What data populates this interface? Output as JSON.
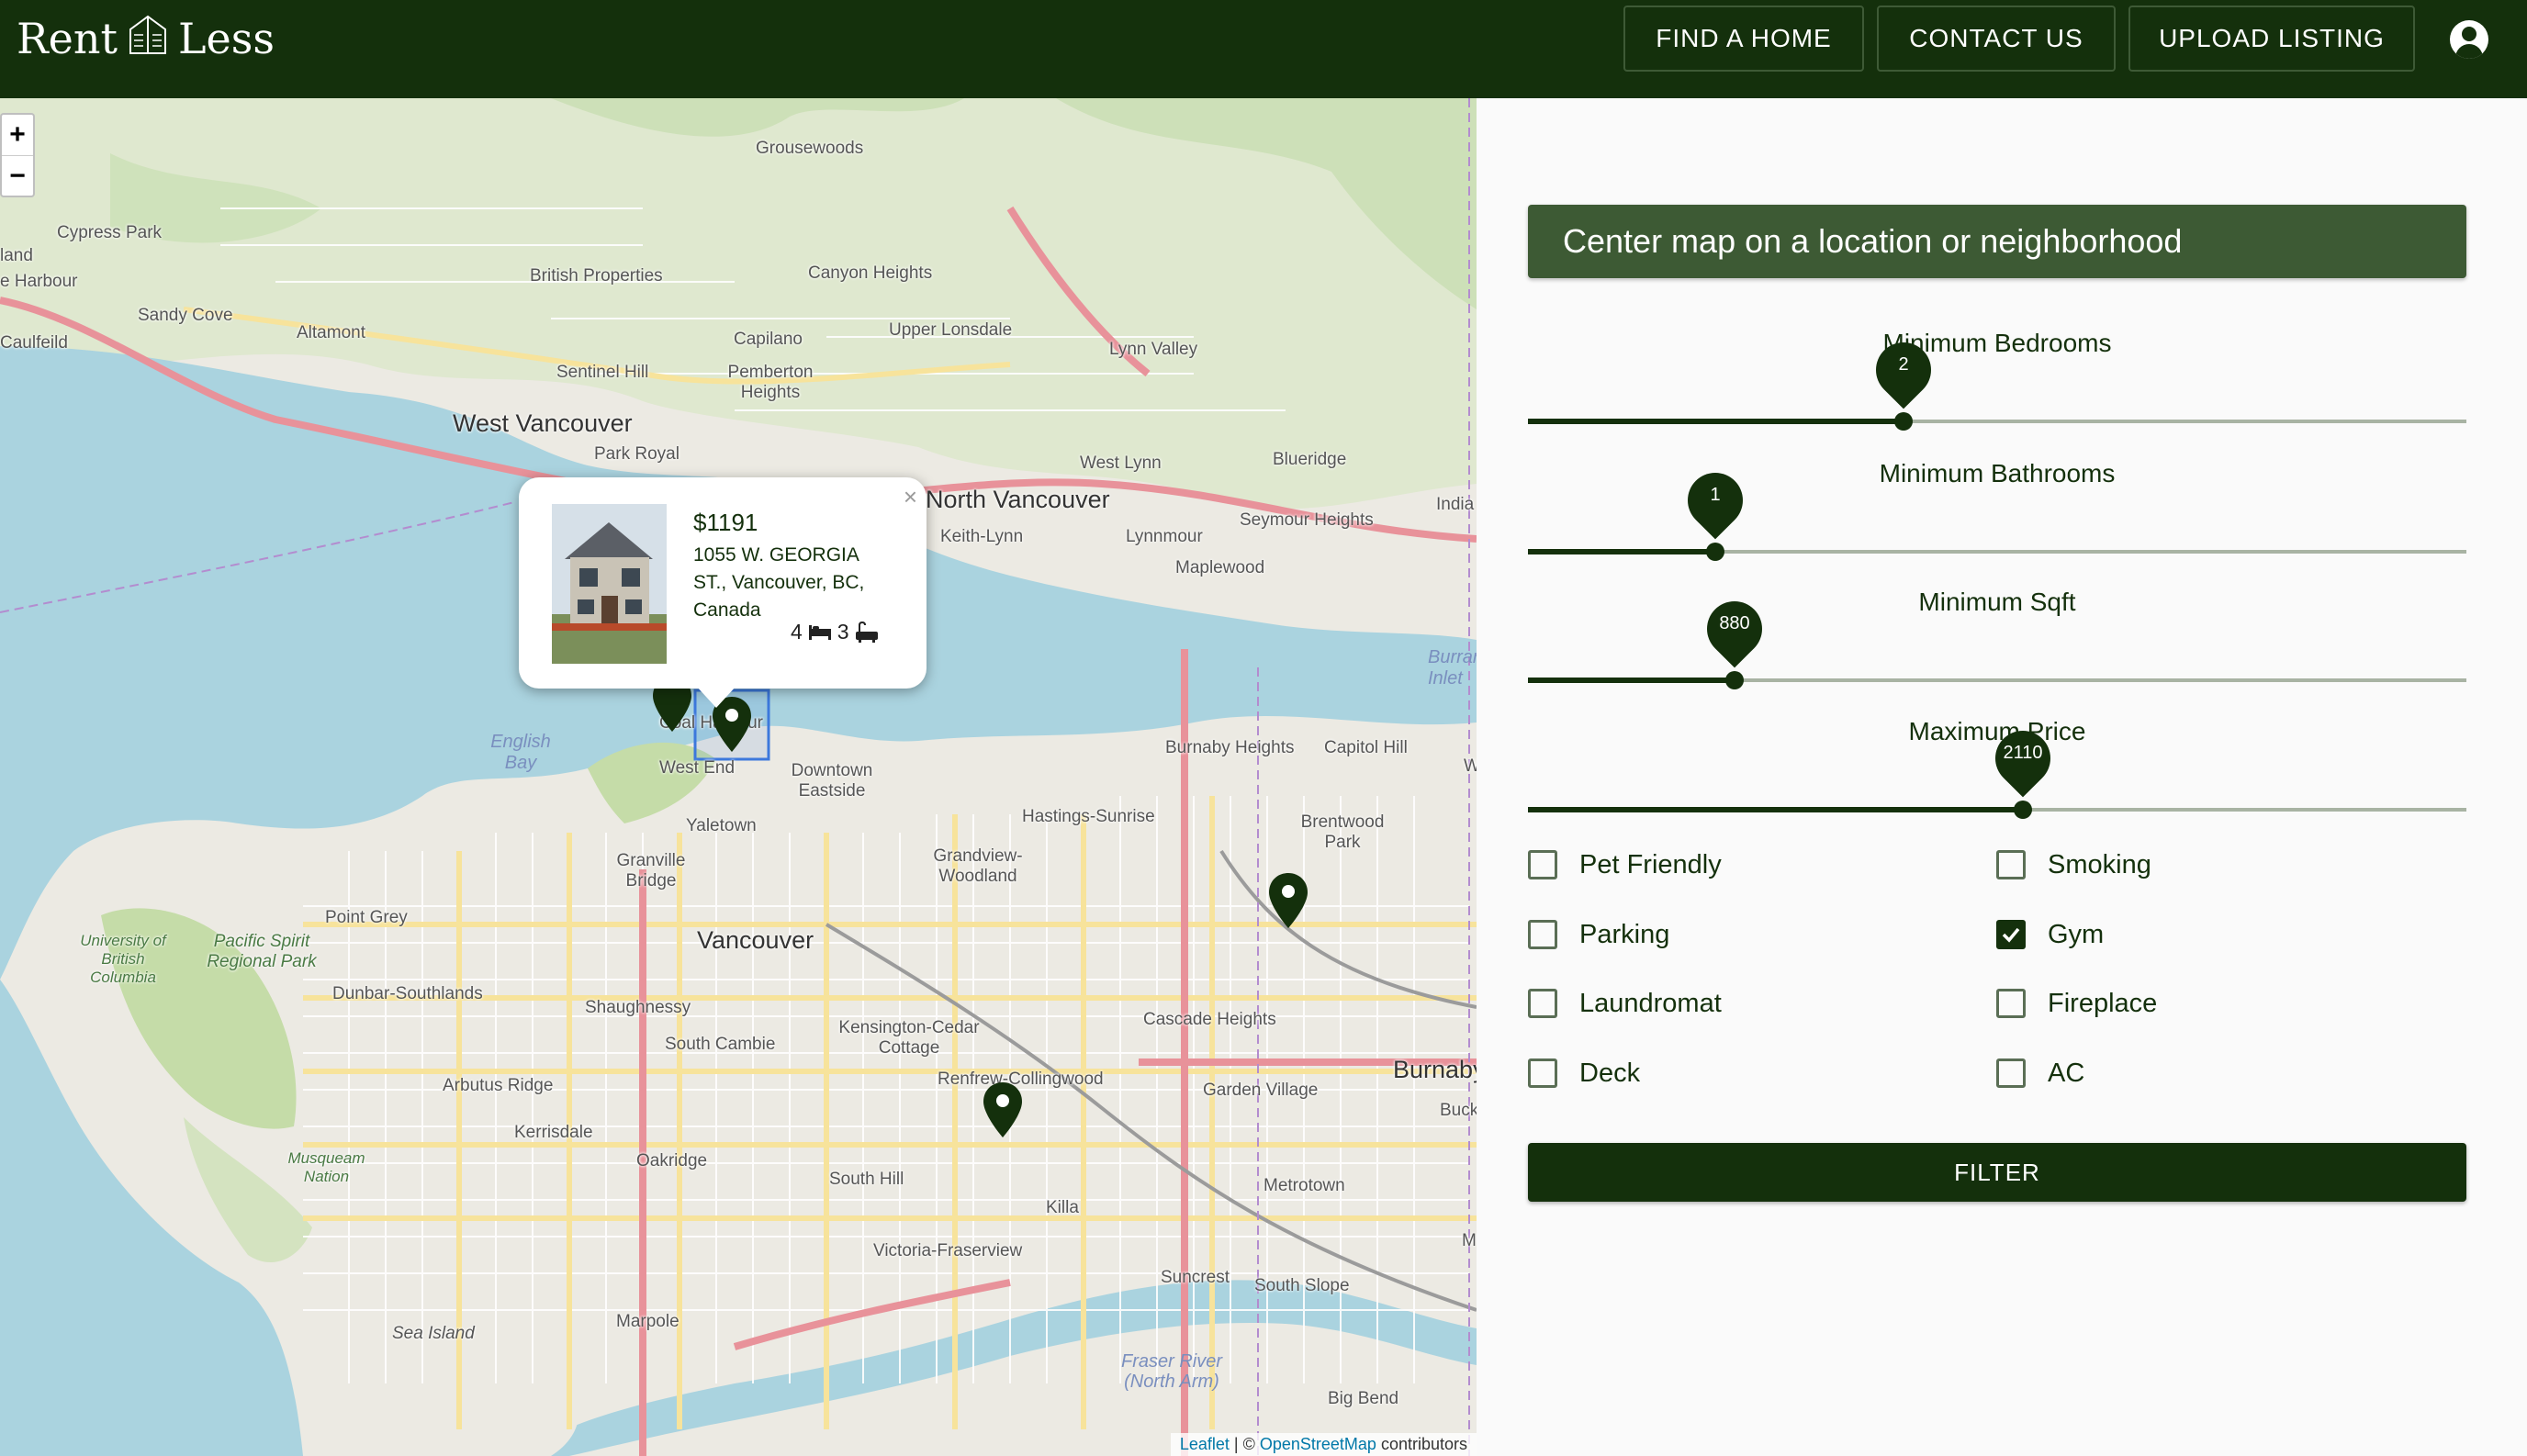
{
  "header": {
    "logo_left": "Rent",
    "logo_right": "Less",
    "nav": [
      "FIND A HOME",
      "CONTACT US",
      "UPLOAD LISTING"
    ]
  },
  "map": {
    "zoom_in": "+",
    "zoom_out": "−",
    "places": [
      "Grousewoods",
      "Cypress Park",
      "British Properties",
      "Canyon Heights",
      "land",
      "e Harbour",
      "Sandy Cove",
      "Altamont",
      "Capilano",
      "Upper Lonsdale",
      "Lynn Valley",
      "Caulfeild",
      "Sentinel Hill",
      "Pemberton Heights",
      "West Vancouver",
      "Park Royal",
      "North Vancouver",
      "West Lynn",
      "Blueridge",
      "Keith-Lynn",
      "Seymour Heights",
      "India",
      "Lynnmour",
      "Maplewood",
      "Burrard Inlet",
      "English Bay",
      "Coal Harbour",
      "West End",
      "Downtown Eastside",
      "Burnaby Heights",
      "Capitol Hill",
      "W",
      "Yaletown",
      "Hastings-Sunrise",
      "Brentwood Park",
      "Granville Bridge",
      "Grandview-Woodland",
      "Point Grey",
      "Vancouver",
      "University of British Columbia",
      "Pacific Spirit Regional Park",
      "Dunbar-Southlands",
      "Kensington-Cedar Cottage",
      "Cascade Heights",
      "Shaughnessy",
      "South Cambie",
      "Renfrew-Collingwood",
      "Burnaby",
      "Arbutus Ridge",
      "Garden Village",
      "Buckingham Heights",
      "Kerrisdale",
      "Oakridge",
      "Musqueam Nation",
      "South Hill",
      "Killa",
      "Metrotown",
      "M",
      "Victoria-Fraserview",
      "Suncrest",
      "South Slope",
      "Sea Island",
      "Marpole",
      "Fraser River (North Arm)",
      "Big Bend"
    ],
    "attribution": {
      "leaflet": "Leaflet",
      "sep": " | © ",
      "osm": "OpenStreetMap",
      "tail": " contributors"
    },
    "popup": {
      "price": "$1191",
      "address": "1055 W. GEORGIA ST., Vancouver, BC, Canada",
      "beds": "4",
      "baths": "3",
      "close": "×"
    }
  },
  "panel": {
    "search_placeholder": "Center map on a location or neighborhood",
    "sliders": [
      {
        "label": "Minimum Bedrooms",
        "value": "2",
        "fraction": 0.4
      },
      {
        "label": "Minimum Bathrooms",
        "value": "1",
        "fraction": 0.2
      },
      {
        "label": "Minimum Sqft",
        "value": "880",
        "fraction": 0.22
      },
      {
        "label": "Maximum Price",
        "value": "2110",
        "fraction": 0.527
      }
    ],
    "amenities": [
      {
        "label": "Pet Friendly",
        "checked": false
      },
      {
        "label": "Smoking",
        "checked": false
      },
      {
        "label": "Parking",
        "checked": false
      },
      {
        "label": "Gym",
        "checked": true
      },
      {
        "label": "Laundromat",
        "checked": false
      },
      {
        "label": "Fireplace",
        "checked": false
      },
      {
        "label": "Deck",
        "checked": false
      },
      {
        "label": "AC",
        "checked": false
      }
    ],
    "filter_label": "FILTER"
  }
}
